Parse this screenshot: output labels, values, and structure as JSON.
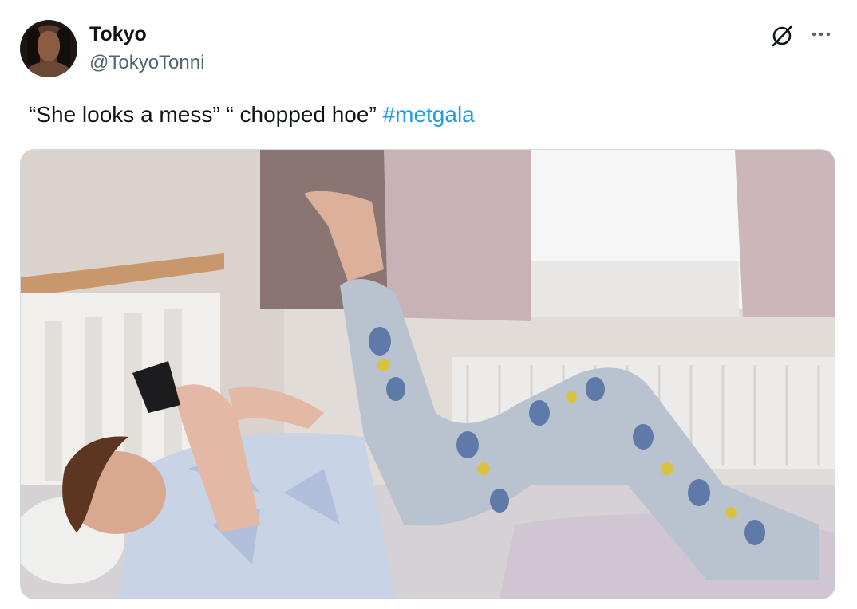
{
  "author": {
    "display_name": "Tokyo",
    "handle": "@TokyoTonni"
  },
  "tweet": {
    "text_plain": "“She looks a mess” “ chopped hoe” ",
    "hashtag": "#metgala"
  },
  "icons": {
    "grok": "grok-slash-circle-icon",
    "more": "more-horizontal-icon"
  },
  "colors": {
    "text": "#0f1419",
    "secondary_text": "#536471",
    "link": "#1d9bf0",
    "media_border": "#cfd9de"
  },
  "media": {
    "alt": "Photo of a person lying on a bed in minion-print pajamas, holding a phone with one leg raised against a window curtain"
  }
}
